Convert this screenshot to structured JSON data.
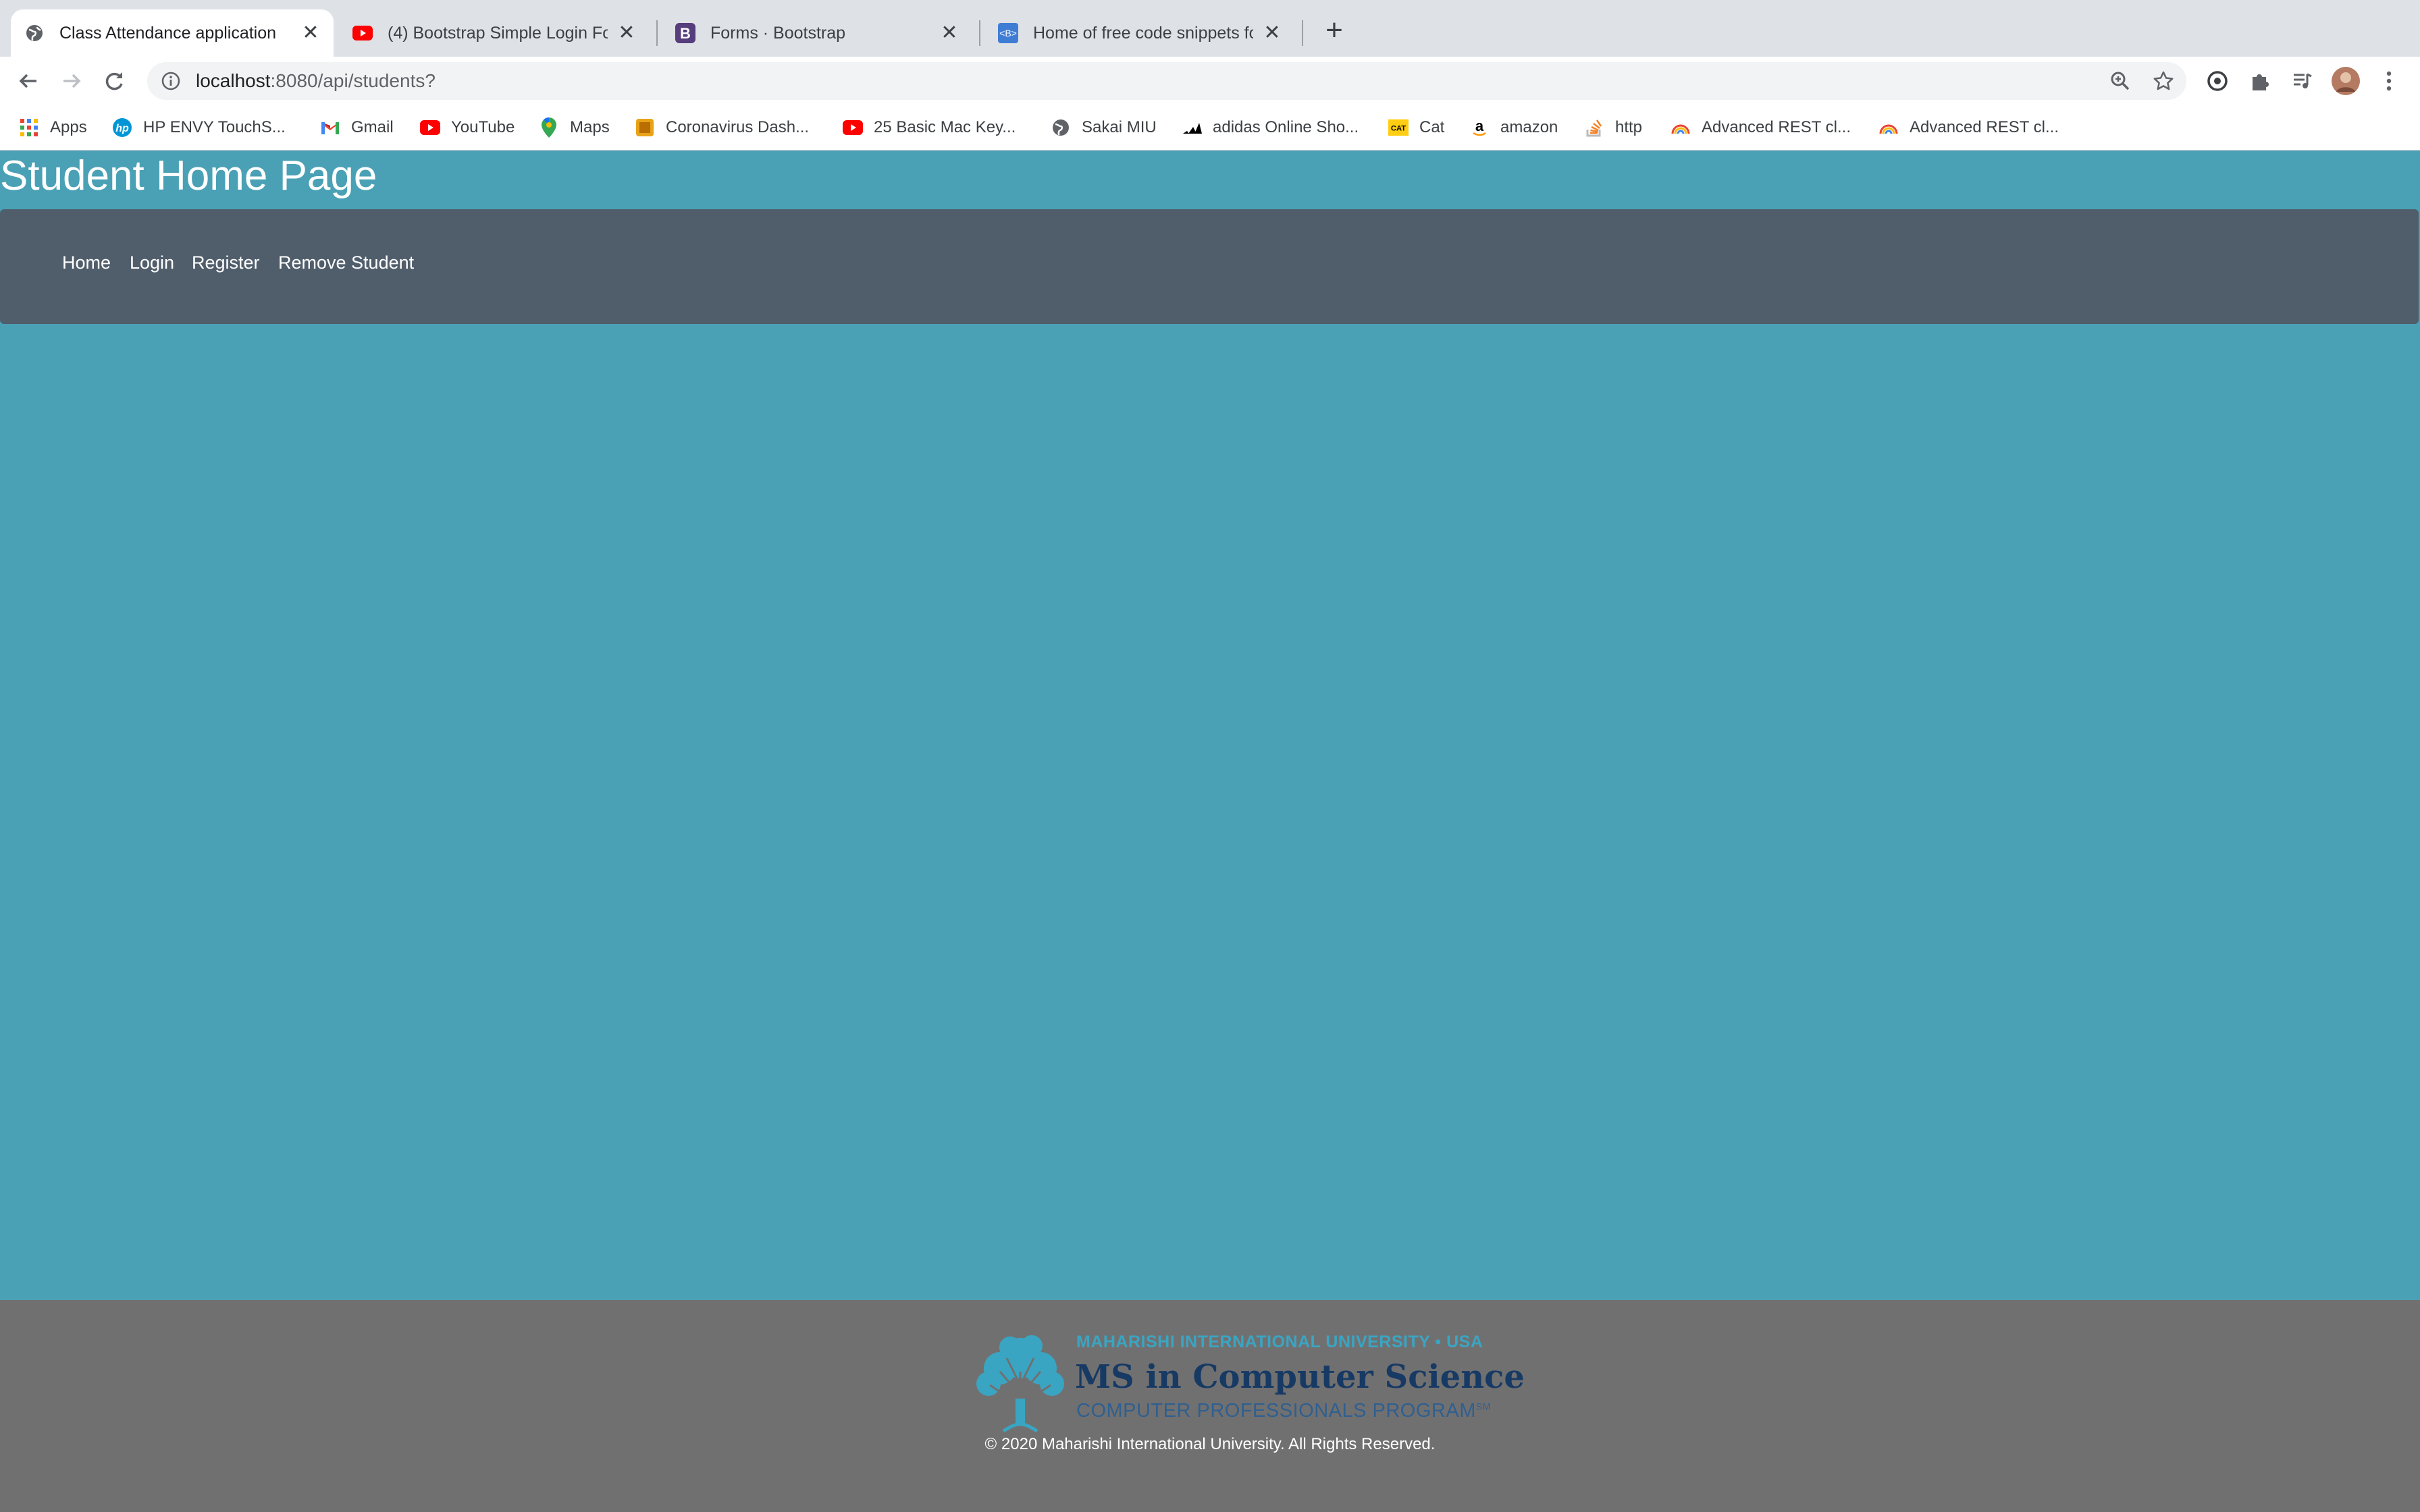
{
  "browser": {
    "tabs": [
      {
        "title": "Class Attendance application",
        "icon": "globe-icon",
        "active": true
      },
      {
        "title": "(4) Bootstrap Simple Login For",
        "icon": "youtube-icon",
        "active": false
      },
      {
        "title": "Forms · Bootstrap",
        "icon": "bootstrap-icon",
        "active": false
      },
      {
        "title": "Home of free code snippets fo",
        "icon": "snippets-icon",
        "active": false
      }
    ],
    "url_host": "localhost",
    "url_path": ":8080/api/students?",
    "bookmarks": [
      {
        "label": "Apps",
        "icon": "apps-grid-icon"
      },
      {
        "label": "HP ENVY TouchS...",
        "icon": "hp-icon"
      },
      {
        "label": "Gmail",
        "icon": "gmail-icon"
      },
      {
        "label": "YouTube",
        "icon": "youtube-icon"
      },
      {
        "label": "Maps",
        "icon": "maps-icon"
      },
      {
        "label": "Coronavirus Dash...",
        "icon": "coronavirus-icon"
      },
      {
        "label": "25 Basic Mac Key...",
        "icon": "youtube-icon"
      },
      {
        "label": "Sakai MIU",
        "icon": "globe-icon"
      },
      {
        "label": "adidas Online Sho...",
        "icon": "adidas-icon"
      },
      {
        "label": "Cat",
        "icon": "cat-icon"
      },
      {
        "label": "amazon",
        "icon": "amazon-icon"
      },
      {
        "label": "http",
        "icon": "stackoverflow-icon"
      },
      {
        "label": "Advanced REST cl...",
        "icon": "rest-client-icon"
      },
      {
        "label": "Advanced REST cl...",
        "icon": "rest-client-icon"
      }
    ]
  },
  "page": {
    "title": "Student Home Page",
    "nav": [
      "Home",
      "Login",
      "Register",
      "Remove Student"
    ]
  },
  "footer": {
    "logo_top": "MAHARISHI INTERNATIONAL UNIVERSITY • USA",
    "logo_main": "MS in Computer Science",
    "logo_sub": "COMPUTER PROFESSIONALS PROGRAM",
    "logo_sm": "SM",
    "copyright": "© 2020 Maharishi International University. All Rights Reserved."
  },
  "colors": {
    "page_bg": "#4aa1b5",
    "navbar_bg": "#505d6b",
    "footer_bg": "#717071"
  }
}
